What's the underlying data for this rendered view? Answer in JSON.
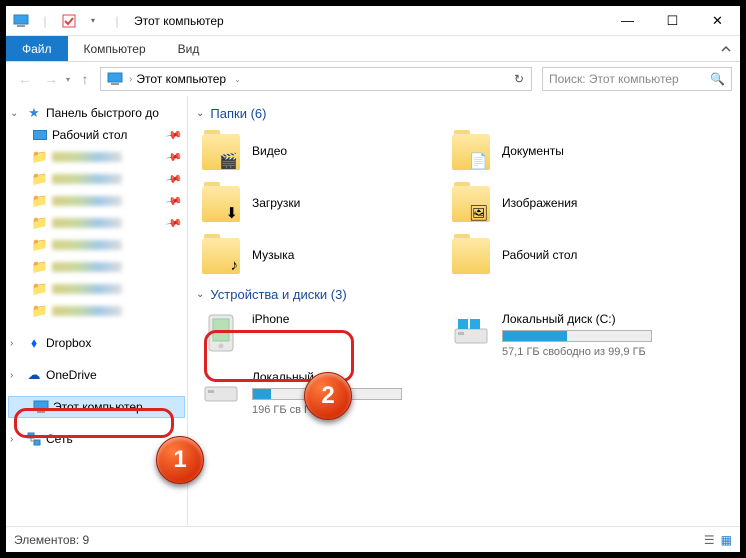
{
  "window": {
    "title": "Этот компьютер"
  },
  "title_btns": {
    "minimize": "—",
    "maximize": "☐",
    "close": "✕"
  },
  "ribbon": {
    "file": "Файл",
    "computer": "Компьютер",
    "view": "Вид"
  },
  "breadcrumb": {
    "root": "Этот компьютер"
  },
  "search": {
    "placeholder": "Поиск: Этот компьютер"
  },
  "tree": {
    "quick_access": "Панель быстрого до",
    "desktop": "Рабочий стол",
    "dropbox": "Dropbox",
    "onedrive": "OneDrive",
    "this_pc": "Этот компьютер",
    "network": "Сеть"
  },
  "sections": {
    "folders": {
      "title": "Папки",
      "count": 6
    },
    "devices": {
      "title": "Устройства и диски",
      "count": 3
    }
  },
  "folders": [
    {
      "name": "Видео",
      "glyph": "🎬"
    },
    {
      "name": "Документы",
      "glyph": "📄"
    },
    {
      "name": "Загрузки",
      "glyph": "⬇"
    },
    {
      "name": "Изображения",
      "glyph": "🖼"
    },
    {
      "name": "Музыка",
      "glyph": "♪"
    },
    {
      "name": "Рабочий стол",
      "glyph": " "
    }
  ],
  "devices": {
    "iphone": {
      "name": "iPhone"
    },
    "c_drive": {
      "name": "Локальный диск (C:)",
      "sub": "57,1 ГБ свободно из 99,9 ГБ",
      "fill_pct": 43
    },
    "d_drive": {
      "name": "Локальный",
      "sub": "196 ГБ св                          ГБ"
    }
  },
  "status": {
    "items_label": "Элементов:",
    "count": 9
  },
  "annotations": {
    "badge1": "1",
    "badge2": "2"
  }
}
